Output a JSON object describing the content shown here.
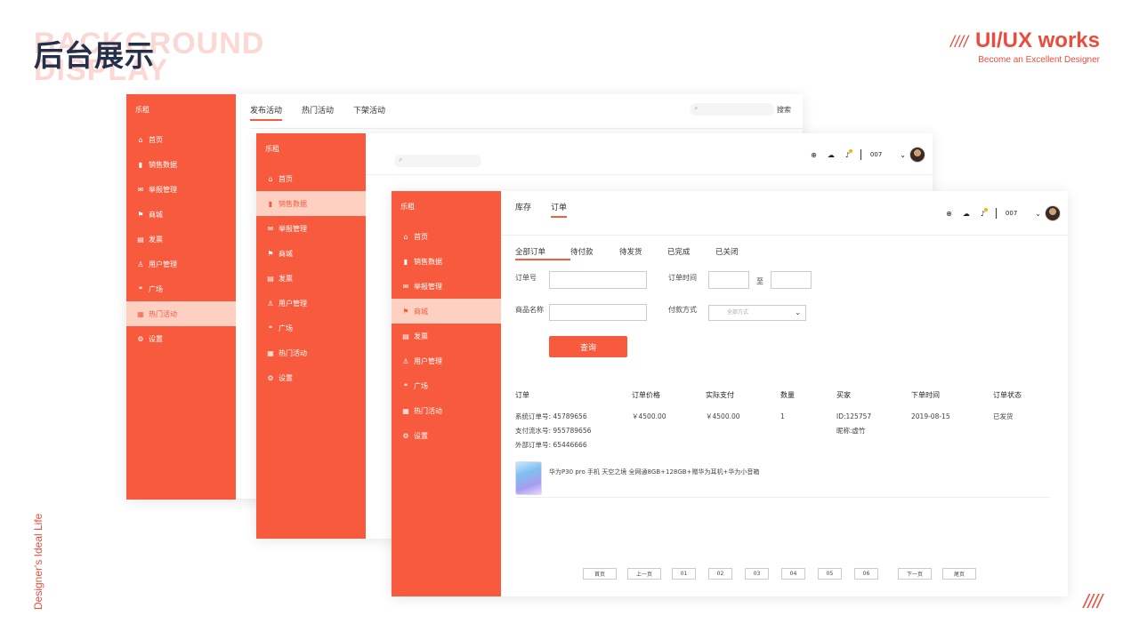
{
  "page": {
    "hero_bg_text_1": "BACKGROUND",
    "hero_bg_text_2": "DISPLAY",
    "title": "后台展示",
    "brand_slashes": "////",
    "brand_name": "UI/UX works",
    "brand_sub": "Become an Excellent Designer",
    "vertical_tag": "Designer's Ideal Life",
    "corner_slashes": "////"
  },
  "colors": {
    "accent": "#f75a3c",
    "accent_light": "#fdd0c2",
    "title": "#243049",
    "brand": "#ea4d3d"
  },
  "sidebar": {
    "brand": "乐租",
    "items": [
      {
        "label": "首页",
        "icon": "home-icon",
        "glyph": "⌂"
      },
      {
        "label": "销售数据",
        "icon": "bar-chart-icon",
        "glyph": "▮"
      },
      {
        "label": "举报管理",
        "icon": "mail-icon",
        "glyph": "✉"
      },
      {
        "label": "商城",
        "icon": "flag-icon",
        "glyph": "⚑"
      },
      {
        "label": "发票",
        "icon": "invoice-icon",
        "glyph": "▤"
      },
      {
        "label": "用户管理",
        "icon": "user-icon",
        "glyph": "♙"
      },
      {
        "label": "广场",
        "icon": "chat-icon",
        "glyph": "❝"
      },
      {
        "label": "热门活动",
        "icon": "calendar-icon",
        "glyph": "▦"
      },
      {
        "label": "设置",
        "icon": "gear-icon",
        "glyph": "⚙"
      }
    ]
  },
  "back_window": {
    "tabs": [
      "发布活动",
      "热门活动",
      "下架活动"
    ],
    "active_tab": 0,
    "search_label": "搜索",
    "active_item": 7
  },
  "mid_window": {
    "active_item": 1,
    "user": "007"
  },
  "front_window": {
    "active_item": 3,
    "top_tabs": [
      "库存",
      "订单"
    ],
    "active_top_tab": 1,
    "user": "007",
    "status_tabs": [
      "全部订单",
      "待付款",
      "待发货",
      "已完成",
      "已关闭"
    ],
    "active_status_tab": 0,
    "filters": {
      "order_no_label": "订单号",
      "order_time_label": "订单时间",
      "to_label": "至",
      "product_name_label": "商品名称",
      "pay_method_label": "付款方式",
      "pay_method_value": "全部方式",
      "query_label": "查询"
    },
    "table": {
      "headers": [
        "订单",
        "订单价格",
        "实际支付",
        "数量",
        "买家",
        "下单时间",
        "订单状态"
      ],
      "row": {
        "system_order": "系统订单号: 45789656",
        "payment_flow": "支付流水号: 955789656",
        "external_order": "外部订单号: 65446666",
        "price": "￥4500.00",
        "paid": "￥4500.00",
        "qty": "1",
        "buyer_id": "ID:125757",
        "buyer_nick": "昵称:虚竹",
        "date": "2019-08-15",
        "status": "已发货",
        "product": "华为P30 pro 手机 天空之境 全网通8GB+128GB+赠华为耳机+华为小音箱"
      }
    },
    "pagination": [
      "首页",
      "上一页",
      "01",
      "02",
      "03",
      "04",
      "05",
      "06",
      "下一页",
      "尾页"
    ]
  }
}
